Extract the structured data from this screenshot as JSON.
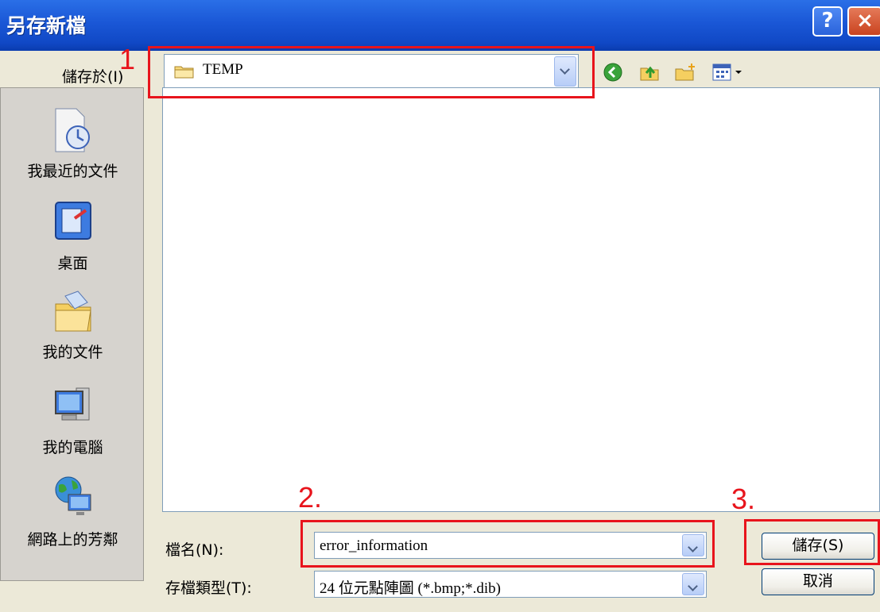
{
  "window": {
    "title": "另存新檔",
    "help_glyph": "?",
    "close_glyph": "×"
  },
  "toolbar": {
    "save_in_label": "儲存於(I)",
    "save_in_value": "TEMP"
  },
  "places": [
    {
      "label": "我最近的文件",
      "icon": "recent-documents-icon"
    },
    {
      "label": "桌面",
      "icon": "desktop-icon"
    },
    {
      "label": "我的文件",
      "icon": "my-documents-icon"
    },
    {
      "label": "我的電腦",
      "icon": "my-computer-icon"
    },
    {
      "label": "網路上的芳鄰",
      "icon": "network-places-icon"
    }
  ],
  "form": {
    "filename_label": "檔名(N):",
    "filename_value": "error_information",
    "filetype_label": "存檔類型(T):",
    "filetype_value": "24 位元點陣圖 (*.bmp;*.dib)"
  },
  "buttons": {
    "save": "儲存(S)",
    "cancel": "取消"
  },
  "annotations": {
    "one": "1",
    "two": "2.",
    "three": "3."
  },
  "colors": {
    "annotation": "#e8141c",
    "titlebar": "#1a57d6"
  }
}
